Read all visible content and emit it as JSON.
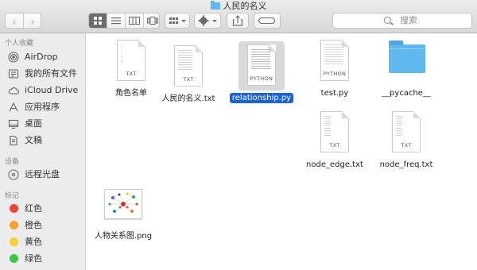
{
  "window": {
    "title": "人民的名义"
  },
  "toolbar": {
    "back_label": "‹",
    "forward_label": "›",
    "search_placeholder": "搜索"
  },
  "sidebar": {
    "favorites_header": "个人收藏",
    "favorites": [
      {
        "label": "AirDrop",
        "icon": "airdrop-icon"
      },
      {
        "label": "我的所有文件",
        "icon": "all-files-icon"
      },
      {
        "label": "iCloud Drive",
        "icon": "icloud-icon"
      },
      {
        "label": "应用程序",
        "icon": "applications-icon"
      },
      {
        "label": "桌面",
        "icon": "desktop-icon"
      },
      {
        "label": "文稿",
        "icon": "documents-icon"
      }
    ],
    "devices_header": "设备",
    "devices": [
      {
        "label": "远程光盘",
        "icon": "remote-disc-icon"
      }
    ],
    "tags_header": "标记",
    "tags": [
      {
        "label": "红色",
        "color": "#f0433a"
      },
      {
        "label": "橙色",
        "color": "#f8a12b"
      },
      {
        "label": "黄色",
        "color": "#f5d130"
      },
      {
        "label": "绿色",
        "color": "#3ec64b"
      }
    ]
  },
  "files": [
    {
      "name": "角色名单",
      "kind": "txt",
      "ext": "TXT"
    },
    {
      "name": "人民的名义.txt",
      "kind": "txt",
      "ext": "TXT"
    },
    {
      "name": "relationship.py",
      "kind": "python",
      "ext": "PYTHON",
      "selected": true
    },
    {
      "name": "test.py",
      "kind": "python",
      "ext": "PYTHON"
    },
    {
      "name": "__pycache__",
      "kind": "folder"
    },
    {
      "name": "node_edge.txt",
      "kind": "txt",
      "ext": "TXT"
    },
    {
      "name": "node_freq.txt",
      "kind": "txt",
      "ext": "TXT"
    },
    {
      "name": "人物关系图.png",
      "kind": "png"
    }
  ],
  "colors": {
    "selection": "#1a62d5",
    "folder": "#5fb8ee"
  }
}
